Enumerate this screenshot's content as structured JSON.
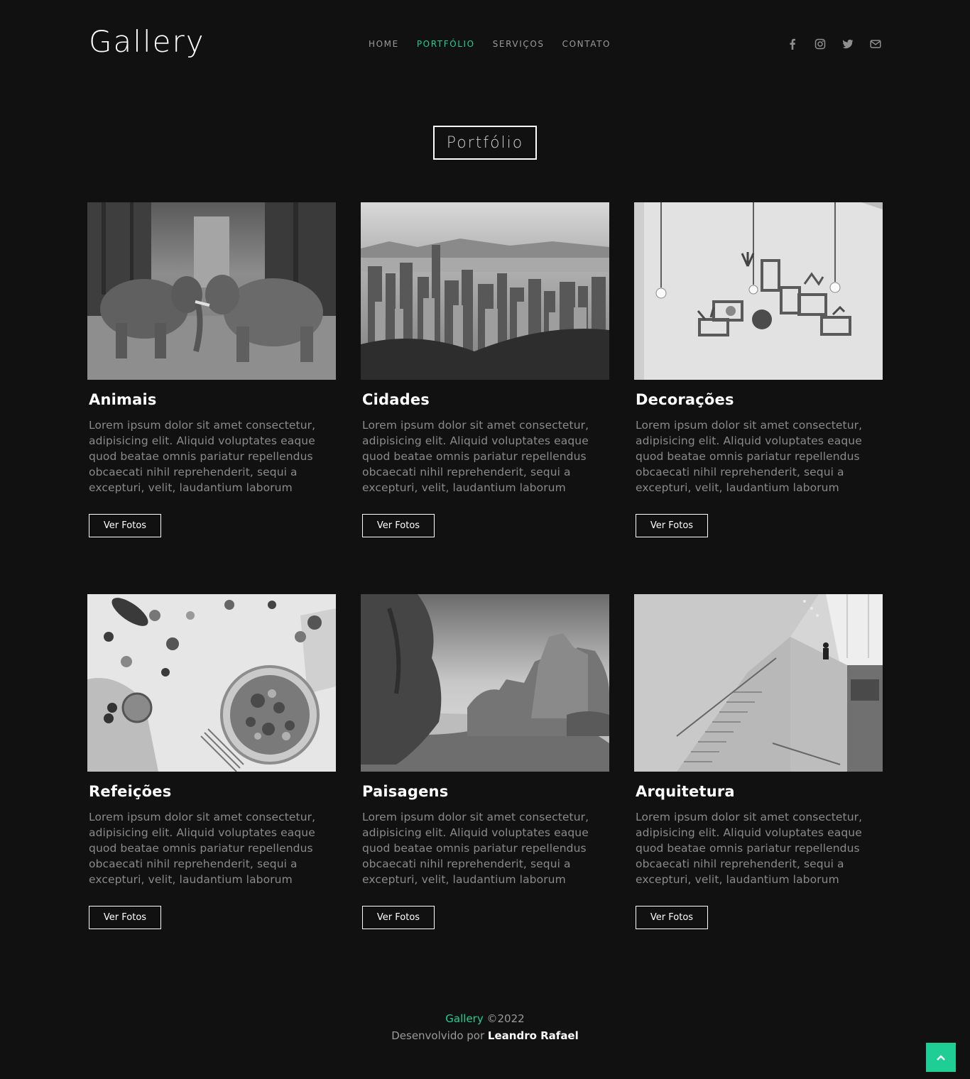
{
  "header": {
    "logo": "Gallery",
    "nav": [
      {
        "label": "HOME",
        "active": false
      },
      {
        "label": "PORTFÓLIO",
        "active": true
      },
      {
        "label": "SERVIÇOS",
        "active": false
      },
      {
        "label": "CONTATO",
        "active": false
      }
    ],
    "social_icons": [
      "facebook-icon",
      "instagram-icon",
      "twitter-icon",
      "mail-icon"
    ]
  },
  "section": {
    "title": "Portfólio"
  },
  "cards": [
    {
      "title": "Animais",
      "text": "Lorem ipsum dolor sit amet consectetur, adipisicing elit. Aliquid voluptates eaque quod beatae omnis pariatur repellendus obcaecati nihil reprehenderit, sequi a excepturi, velit, laudantium laborum",
      "button": "Ver Fotos",
      "image": "elephants-photo"
    },
    {
      "title": "Cidades",
      "text": "Lorem ipsum dolor sit amet consectetur, adipisicing elit. Aliquid voluptates eaque quod beatae omnis pariatur repellendus obcaecati nihil reprehenderit, sequi a excepturi, velit, laudantium laborum",
      "button": "Ver Fotos",
      "image": "city-skyline-photo"
    },
    {
      "title": "Decorações",
      "text": "Lorem ipsum dolor sit amet consectetur, adipisicing elit. Aliquid voluptates eaque quod beatae omnis pariatur repellendus obcaecati nihil reprehenderit, sequi a excepturi, velit, laudantium laborum",
      "button": "Ver Fotos",
      "image": "wall-shelves-photo"
    },
    {
      "title": "Refeições",
      "text": "Lorem ipsum dolor sit amet consectetur, adipisicing elit. Aliquid voluptates eaque quod beatae omnis pariatur repellendus obcaecati nihil reprehenderit, sequi a excepturi, velit, laudantium laborum",
      "button": "Ver Fotos",
      "image": "food-bowl-photo"
    },
    {
      "title": "Paisagens",
      "text": "Lorem ipsum dolor sit amet consectetur, adipisicing elit. Aliquid voluptates eaque quod beatae omnis pariatur repellendus obcaecati nihil reprehenderit, sequi a excepturi, velit, laudantium laborum",
      "button": "Ver Fotos",
      "image": "coastal-cliffs-photo"
    },
    {
      "title": "Arquitetura",
      "text": "Lorem ipsum dolor sit amet consectetur, adipisicing elit. Aliquid voluptates eaque quod beatae omnis pariatur repellendus obcaecati nihil reprehenderit, sequi a excepturi, velit, laudantium laborum",
      "button": "Ver Fotos",
      "image": "staircase-photo"
    }
  ],
  "footer": {
    "brand": "Gallery",
    "copyright": " ©2022",
    "developed_by": "Desenvolvido por ",
    "author": "Leandro Rafael"
  },
  "colors": {
    "background": "#111111",
    "accent": "#1fce95",
    "muted_text": "#8a8a8a"
  }
}
